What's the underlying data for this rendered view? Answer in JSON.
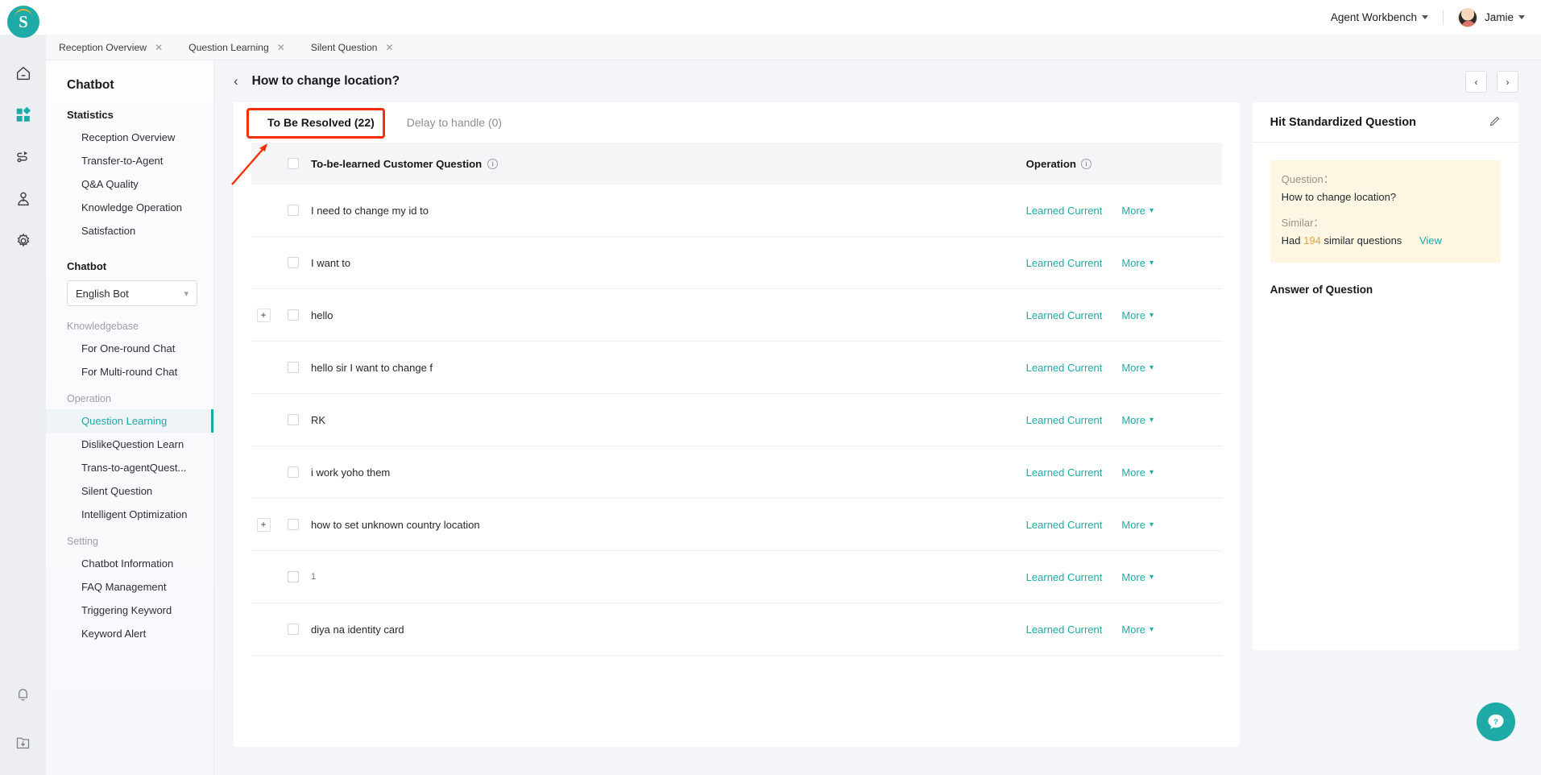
{
  "topbar": {
    "workbench_label": "Agent Workbench",
    "username": "Jamie",
    "logo_letter": "S"
  },
  "browser_tabs": [
    {
      "label": "Reception Overview",
      "close": "✕"
    },
    {
      "label": "Question Learning",
      "close": "✕"
    },
    {
      "label": "Silent Question",
      "close": "✕"
    }
  ],
  "rail_icons": [
    {
      "name": "home-icon"
    },
    {
      "name": "apps-icon"
    },
    {
      "name": "workflow-icon"
    },
    {
      "name": "contact-icon"
    },
    {
      "name": "gear-icon"
    }
  ],
  "rail_bottom_icons": [
    {
      "name": "bell-icon"
    },
    {
      "name": "download-folder-icon"
    }
  ],
  "sidebar": {
    "title": "Chatbot",
    "statistics_header": "Statistics",
    "statistics_items": [
      "Reception Overview",
      "Transfer-to-Agent",
      "Q&A Quality",
      "Knowledge Operation",
      "Satisfaction"
    ],
    "chatbot_header": "Chatbot",
    "bot_select_value": "English Bot",
    "knowledgebase_group": "Knowledgebase",
    "knowledgebase_items": [
      "For One-round Chat",
      "For Multi-round Chat"
    ],
    "operation_group": "Operation",
    "operation_items": [
      "Question Learning",
      "DislikeQuestion Learn",
      "Trans-to-agentQuest...",
      "Silent Question",
      "Intelligent Optimization"
    ],
    "operation_active_index": 0,
    "setting_group": "Setting",
    "setting_items": [
      "Chatbot Information",
      "FAQ Management",
      "Triggering Keyword",
      "Keyword Alert"
    ]
  },
  "page": {
    "title": "How to change location?",
    "back_icon": "‹",
    "prev_icon": "‹",
    "next_icon": "›"
  },
  "tabs": [
    {
      "label": "To Be Resolved (22)",
      "active": true
    },
    {
      "label": "Delay to handle (0)",
      "active": false
    }
  ],
  "table": {
    "col_question": "To-be-learned Customer Question",
    "col_operation": "Operation",
    "action_learned": "Learned Current",
    "action_more": "More",
    "rows": [
      {
        "question": "I need to change my id to",
        "expandable": false
      },
      {
        "question": "I want to",
        "expandable": false
      },
      {
        "question": "hello",
        "expandable": true
      },
      {
        "question": "hello sir I want to change f",
        "expandable": false
      },
      {
        "question": "RK",
        "expandable": false
      },
      {
        "question": "i work yoho them",
        "expandable": false
      },
      {
        "question": "how to set unknown country location",
        "expandable": true
      },
      {
        "question": "1",
        "expandable": false
      },
      {
        "question": "diya na identity card",
        "expandable": false
      }
    ]
  },
  "right_panel": {
    "title": "Hit Standardized Question",
    "question_label": "Question：",
    "question_value": "How to change location?",
    "similar_label": "Similar：",
    "similar_prefix": "Had",
    "similar_count": "194",
    "similar_suffix": "similar questions",
    "view_link": "View",
    "answer_header": "Answer of Question"
  },
  "colors": {
    "accent": "#1eaaa6",
    "highlight_red": "#f42f09",
    "amber": "#e8a33d",
    "note_bg": "#fdf6e3"
  },
  "fab": {
    "icon": "?"
  }
}
